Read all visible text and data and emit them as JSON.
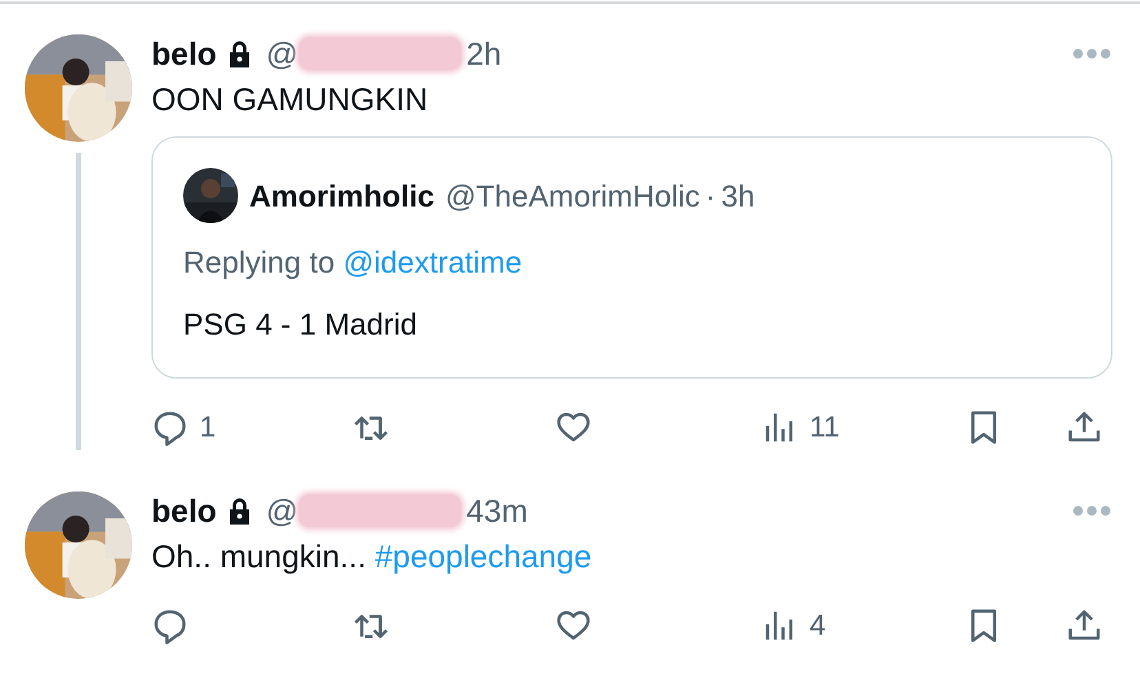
{
  "tweets": [
    {
      "avatar": {
        "kind": "picture"
      },
      "name": "belo",
      "locked": true,
      "handle": "@",
      "handle_redacted": true,
      "time": "2h",
      "thread_line": true,
      "text": [
        {
          "text": "OON GAMUNGKIN"
        }
      ],
      "quote": {
        "avatar": {
          "kind": "picture"
        },
        "name": "Amorimholic",
        "handle": "@TheAmorimHolic",
        "separator": "·",
        "time": "3h",
        "replying_prefix": "Replying to",
        "replying_to": "@idextratime",
        "text": "PSG 4 - 1 Madrid"
      },
      "actions": [
        {
          "kind": "reply",
          "count": "1"
        },
        {
          "kind": "repost"
        },
        {
          "kind": "like"
        },
        {
          "kind": "views",
          "count": "11"
        },
        {
          "kind": "bookmark"
        },
        {
          "kind": "share"
        }
      ]
    },
    {
      "avatar": {
        "kind": "picture"
      },
      "name": "belo",
      "locked": true,
      "handle": "@",
      "handle_redacted": true,
      "time": "43m",
      "thread_line": false,
      "text": [
        {
          "text": "Oh.. mungkin... "
        },
        {
          "text": "#peoplechange",
          "kind": "hashtag"
        }
      ],
      "actions": [
        {
          "kind": "reply"
        },
        {
          "kind": "repost"
        },
        {
          "kind": "like"
        },
        {
          "kind": "views",
          "count": "4"
        },
        {
          "kind": "bookmark"
        },
        {
          "kind": "share"
        }
      ]
    }
  ]
}
